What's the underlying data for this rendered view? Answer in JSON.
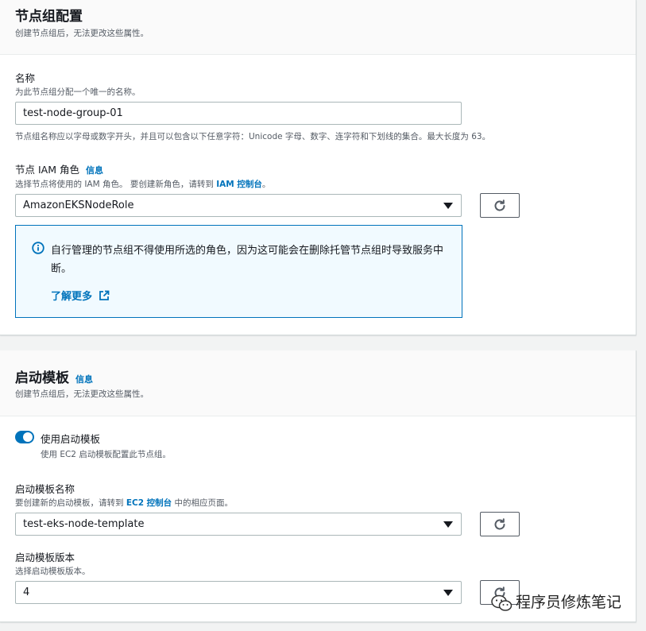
{
  "nodegroup_config": {
    "title": "节点组配置",
    "description": "创建节点组后，无法更改这些属性。",
    "name": {
      "label": "名称",
      "description": "为此节点组分配一个唯一的名称。",
      "value": "test-node-group-01",
      "constraint": "节点组名称应以字母或数字开头，并且可以包含以下任意字符：Unicode 字母、数字、连字符和下划线的集合。最大长度为 63。"
    },
    "iam_role": {
      "label": "节点 IAM 角色",
      "info_link": "信息",
      "description_prefix": "选择节点将使用的 IAM 角色。 要创建新角色，请转到 ",
      "description_link": "IAM 控制台",
      "description_suffix": "。",
      "selected": "AmazonEKSNodeRole"
    },
    "alert": {
      "text": "自行管理的节点组不得使用所选的角色，因为这可能会在删除托管节点组时导致服务中断。",
      "link": "了解更多"
    }
  },
  "launch_template": {
    "title": "启动模板",
    "info_link": "信息",
    "description": "创建节点组后，无法更改这些属性。",
    "toggle": {
      "label": "使用启动模板",
      "description": "使用 EC2 启动模板配置此节点组。",
      "on": true
    },
    "template_name": {
      "label": "启动模板名称",
      "description_prefix": "要创建新的启动模板，请转到 ",
      "description_link": "EC2 控制台",
      "description_suffix": " 中的相应页面。",
      "selected": "test-eks-node-template"
    },
    "template_version": {
      "label": "启动模板版本",
      "description": "选择启动模板版本。",
      "selected": "4"
    }
  },
  "watermark": {
    "text": "程序员修炼笔记",
    "icon": "wechat-icon"
  },
  "colors": {
    "link": "#0073bb",
    "alert_border": "#0073bb",
    "alert_bg": "#f1faff",
    "toggle_on": "#0073bb"
  }
}
